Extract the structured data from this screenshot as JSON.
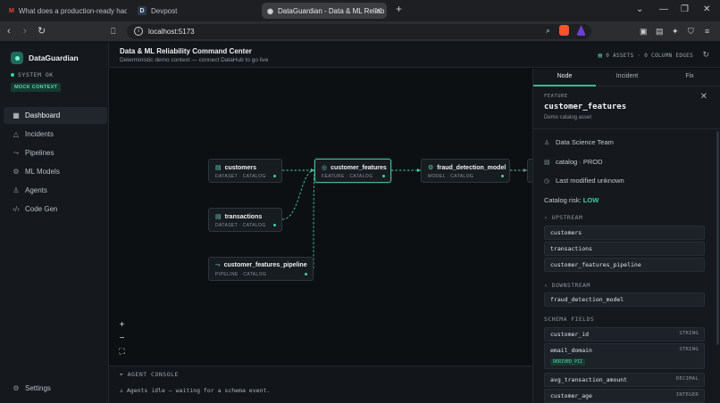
{
  "browser": {
    "tabs": [
      {
        "label": "What does a production-ready hacka",
        "icon": "gmail-icon"
      },
      {
        "label": "Devpost",
        "icon": "devpost-icon"
      },
      {
        "label": "DataGuardian - Data & ML Reliab",
        "icon": "dataguardian-icon"
      }
    ],
    "url": "localhost:5173"
  },
  "sidebar": {
    "app_name": "DataGuardian",
    "status": "SYSTEM OK",
    "badge": "MOCK CONTEXT",
    "items": [
      {
        "label": "Dashboard",
        "icon": "dashboard-icon"
      },
      {
        "label": "Incidents",
        "icon": "alert-icon"
      },
      {
        "label": "Pipelines",
        "icon": "pipeline-icon"
      },
      {
        "label": "ML Models",
        "icon": "model-icon"
      },
      {
        "label": "Agents",
        "icon": "agent-icon"
      },
      {
        "label": "Code Gen",
        "icon": "code-icon"
      }
    ],
    "settings": "Settings"
  },
  "header": {
    "title": "Data & ML Reliability Command Center",
    "subtitle": "Deterministic demo context — connect DataHub to go live",
    "stats": "0 ASSETS · 0 COLUMN EDGES"
  },
  "graph": {
    "nodes": [
      {
        "name": "customers",
        "sub": "DATASET · CATALOG",
        "icon": "table-icon"
      },
      {
        "name": "transactions",
        "sub": "DATASET · CATALOG",
        "icon": "table-icon"
      },
      {
        "name": "customer_features_pipeline",
        "sub": "PIPELINE · CATALOG",
        "icon": "pipeline-icon"
      },
      {
        "name": "customer_features",
        "sub": "FEATURE · CATALOG",
        "icon": "feature-icon"
      },
      {
        "name": "fraud_detection_model",
        "sub": "MODEL · CATALOG",
        "icon": "model-icon"
      }
    ]
  },
  "console": {
    "title": "AGENT CONSOLE",
    "message": "Agents idle — waiting for a schema event."
  },
  "panel": {
    "tabs": [
      "Node",
      "Incident",
      "Fix"
    ],
    "kind": "FEATURE",
    "name": "customer_features",
    "desc": "Demo catalog asset",
    "owner": "Data Science Team",
    "env": "catalog · PROD",
    "modified": "Last modified unknown",
    "risk_label": "Catalog risk:",
    "risk_value": "LOW",
    "upstream_title": "UPSTREAM",
    "upstream": [
      "customers",
      "transactions",
      "customer_features_pipeline"
    ],
    "downstream_title": "DOWNSTREAM",
    "downstream": [
      "fraud_detection_model"
    ],
    "schema_title": "SCHEMA FIELDS",
    "fields": [
      {
        "name": "customer_id",
        "type": "STRING"
      },
      {
        "name": "email_domain",
        "type": "STRING",
        "badge": "DERIVED_PII"
      },
      {
        "name": "avg_transaction_amount",
        "type": "DECIMAL"
      },
      {
        "name": "customer_age",
        "type": "INTEGER"
      }
    ]
  },
  "colors": {
    "accent": "#3fb894",
    "background": "#0d1013",
    "panel": "#15191d"
  }
}
